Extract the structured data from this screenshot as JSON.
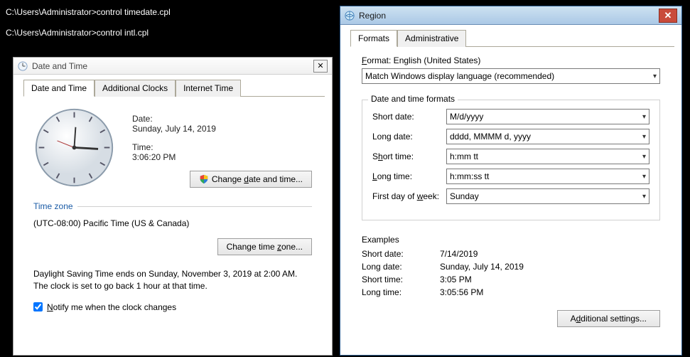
{
  "cmd": {
    "line1": "C:\\Users\\Administrator>control timedate.cpl",
    "line2": "C:\\Users\\Administrator>control intl.cpl"
  },
  "dateTime": {
    "title": "Date and Time",
    "close": "✕",
    "tabs": {
      "dateAndTime": "Date and Time",
      "additionalClocks": "Additional Clocks",
      "internetTime": "Internet Time"
    },
    "dateLabel": "Date:",
    "dateValue": "Sunday, July 14, 2019",
    "timeLabel": "Time:",
    "timeValue": "3:06:20 PM",
    "changeDateTime": "Change date and time...",
    "timeZoneLabel": "Time zone",
    "timeZoneValue": "(UTC-08:00) Pacific Time (US & Canada)",
    "changeTimeZone": "Change time zone...",
    "dstText": "Daylight Saving Time ends on Sunday, November 3, 2019 at 2:00 AM. The clock is set to go back 1 hour at that time.",
    "notifyLabel": "Notify me when the clock changes"
  },
  "region": {
    "title": "Region",
    "close": "✕",
    "tabs": {
      "formats": "Formats",
      "administrative": "Administrative"
    },
    "formatLabelPrefix": "F",
    "formatLabelRest": "ormat: English (United States)",
    "formatSelect": "Match Windows display language (recommended)",
    "dtFormatsTitle": "Date and time formats",
    "fields": {
      "shortDate": {
        "label": "Short date:",
        "value": "M/d/yyyy"
      },
      "longDate": {
        "label": "Long date:",
        "value": "dddd, MMMM d, yyyy"
      },
      "shortTime": {
        "label": "Short time:",
        "value": "h:mm tt"
      },
      "longTime": {
        "label": "Long time:",
        "value": "h:mm:ss tt"
      },
      "firstDay": {
        "label": "First day of week:",
        "value": "Sunday"
      }
    },
    "examplesTitle": "Examples",
    "examples": {
      "shortDate": {
        "label": "Short date:",
        "value": "7/14/2019"
      },
      "longDate": {
        "label": "Long date:",
        "value": "Sunday, July 14, 2019"
      },
      "shortTime": {
        "label": "Short time:",
        "value": "3:05 PM"
      },
      "longTime": {
        "label": "Long time:",
        "value": "3:05:56 PM"
      }
    },
    "additionalSettings": "Additional settings..."
  }
}
